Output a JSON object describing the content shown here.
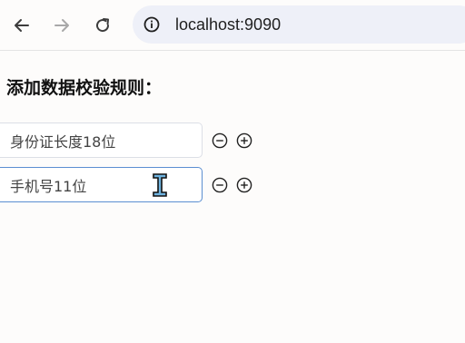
{
  "browser": {
    "url": "localhost:9090",
    "back_icon": "arrow-left-icon",
    "forward_icon": "arrow-right-icon",
    "reload_icon": "reload-icon",
    "info_icon": "info-circle-icon"
  },
  "page": {
    "title": "添加数据校验规则："
  },
  "rules": [
    {
      "value": "身份证长度18位",
      "remove_icon": "minus-circle-icon",
      "add_icon": "plus-circle-icon"
    },
    {
      "value": "手机号11位",
      "remove_icon": "minus-circle-icon",
      "add_icon": "plus-circle-icon"
    }
  ],
  "colors": {
    "focus_border": "#5b8ed1",
    "omnibox_bg": "#eef0f8"
  }
}
